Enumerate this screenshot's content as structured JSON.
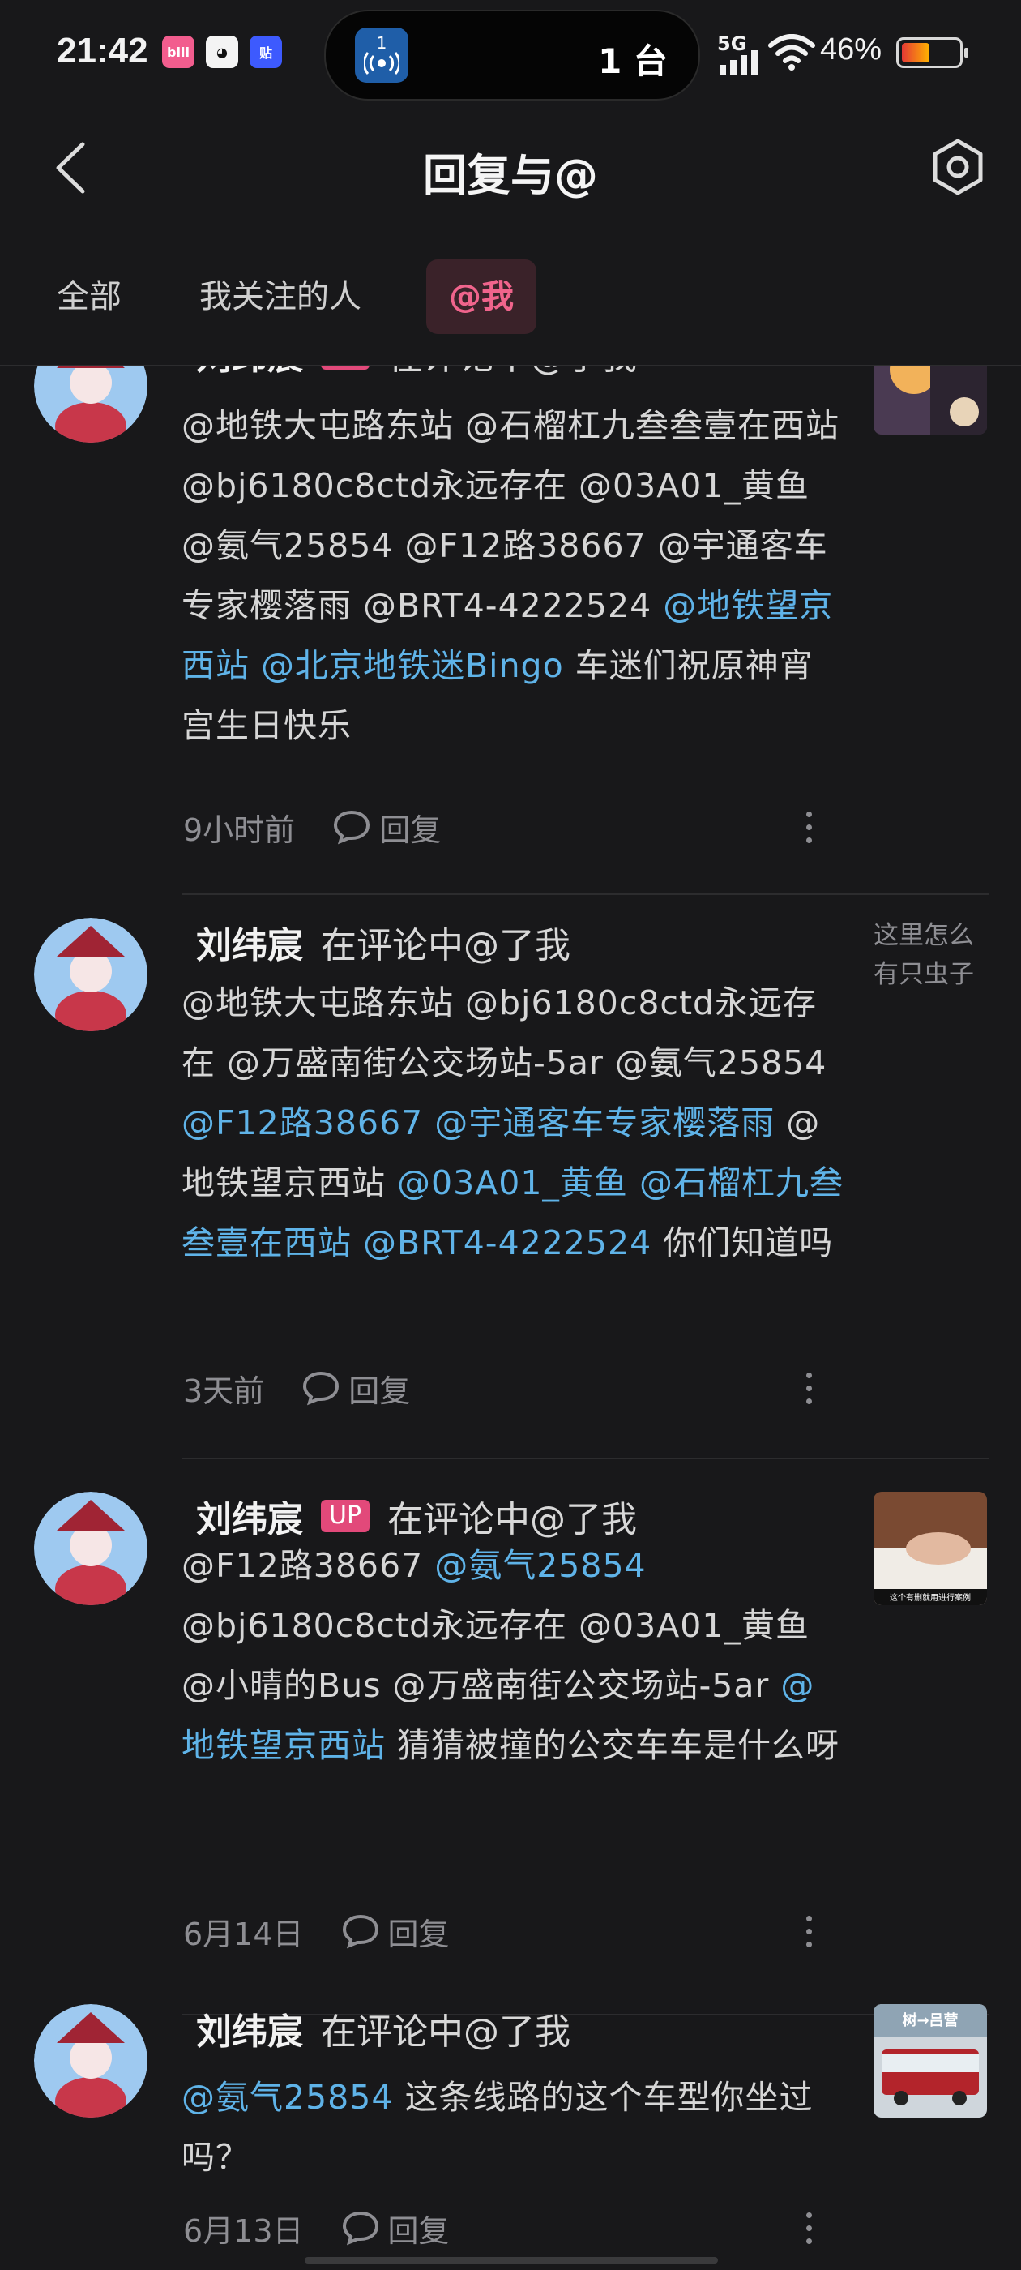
{
  "status_bar": {
    "time": "21:42",
    "app_icons": [
      "bilibili-icon",
      "qq-icon",
      "tieba-icon"
    ],
    "live_badge": "1",
    "device_count": "1 台",
    "signal": "5G",
    "battery_percent": "46%"
  },
  "header": {
    "title": "回复与@",
    "back_icon": "chevron-left-icon",
    "settings_icon": "settings-icon"
  },
  "tabs": [
    {
      "label": "全部",
      "active": false
    },
    {
      "label": "我关注的人",
      "active": false
    },
    {
      "label": "@我",
      "active": true
    }
  ],
  "reply_label": "回复",
  "items": [
    {
      "user": "刘纬宸",
      "badge": "UP",
      "action": "在评论中@了我",
      "parts": [
        {
          "t": "@地铁大屯路东站 @石榴杠九叁叁壹在西站 @bj6180c8ctd永远存在 @03A01_黄鱼 @氨气25854 @F12路38667 @宇通客车专家樱落雨 @BRT4-4222524 ",
          "m": false
        },
        {
          "t": "@地铁望京西站",
          "m": true
        },
        {
          "t": " ",
          "m": false
        },
        {
          "t": "@北京地铁迷Bingo",
          "m": true
        },
        {
          "t": " 车迷们祝原神宵宫生日快乐",
          "m": false
        }
      ],
      "time": "9小时前"
    },
    {
      "user": "刘纬宸",
      "badge": "",
      "action": "在评论中@了我",
      "parts": [
        {
          "t": "@地铁大屯路东站 @bj6180c8ctd永远存在 @万盛南街公交场站-5ar @氨气25854 ",
          "m": false
        },
        {
          "t": "@F12路38667",
          "m": true
        },
        {
          "t": " ",
          "m": false
        },
        {
          "t": "@宇通客车专家樱落雨",
          "m": true
        },
        {
          "t": " @地铁望京西站 ",
          "m": false
        },
        {
          "t": "@03A01_黄鱼",
          "m": true
        },
        {
          "t": " ",
          "m": false
        },
        {
          "t": "@石榴杠九叁叁壹在西站",
          "m": true
        },
        {
          "t": " ",
          "m": false
        },
        {
          "t": "@BRT4-4222524",
          "m": true
        },
        {
          "t": " 你们知道吗",
          "m": false
        }
      ],
      "time": "3天前",
      "snippet": "这里怎么有只虫子"
    },
    {
      "user": "刘纬宸",
      "badge": "UP",
      "action": "在评论中@了我",
      "parts": [
        {
          "t": "@F12路38667 ",
          "m": false
        },
        {
          "t": "@氨气25854",
          "m": true
        },
        {
          "t": " @bj6180c8ctd永远存在 @03A01_黄鱼 @小晴的Bus @万盛南街公交场站-5ar ",
          "m": false
        },
        {
          "t": "@地铁望京西站",
          "m": true
        },
        {
          "t": " 猜猜被撞的公交车车是什么呀",
          "m": false
        }
      ],
      "time": "6月14日",
      "thumb_caption": "这个有删就用进行案例"
    },
    {
      "user": "刘纬宸",
      "badge": "",
      "action": "在评论中@了我",
      "parts": [
        {
          "t": "@氨气25854",
          "m": true
        },
        {
          "t": " 这条线路的这个车型你坐过吗？",
          "m": false
        }
      ],
      "time": "6月13日",
      "thumb_caption": "树→吕营"
    }
  ]
}
